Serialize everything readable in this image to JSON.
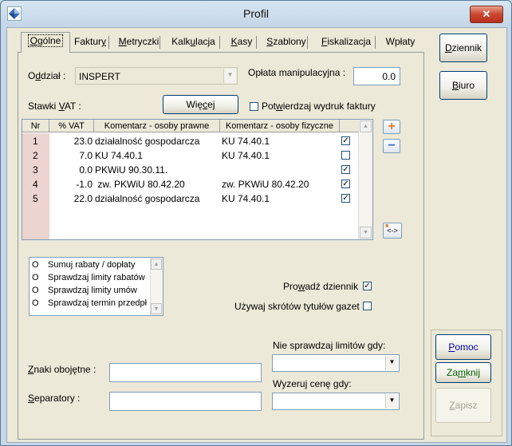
{
  "window": {
    "title": "Profil",
    "close_label": "✕"
  },
  "tabs": [
    {
      "pre": "",
      "u": "O",
      "post": "gólne",
      "active": true
    },
    {
      "pre": "Faktur",
      "u": "y",
      "post": ""
    },
    {
      "pre": "",
      "u": "M",
      "post": "etryczki"
    },
    {
      "pre": "Kalk",
      "u": "u",
      "post": "lacja"
    },
    {
      "pre": "",
      "u": "K",
      "post": "asy"
    },
    {
      "pre": "",
      "u": "S",
      "post": "zablony"
    },
    {
      "pre": "",
      "u": "F",
      "post": "iskalizacja"
    },
    {
      "pre": "",
      "u": "",
      "post": "Wpłaty"
    }
  ],
  "oddzial": {
    "label_pre": "O",
    "label_u": "d",
    "label_post": "dział :",
    "value": "INSPERT"
  },
  "oplata": {
    "label": "Opłata manipulacyjna :",
    "value": "0.0"
  },
  "stawki": {
    "label_pre": "Stawki ",
    "label_u": "V",
    "label_post": "AT :",
    "wiecej_pre": "Wię",
    "wiecej_u": "c",
    "wiecej_post": "ej"
  },
  "potwierdzaj": {
    "label_pre": "Pot",
    "label_u": "w",
    "label_post": "ierdzaj wydruk faktury"
  },
  "grid": {
    "headers": [
      "Nr",
      "% VAT",
      "Komentarz - osoby prawne",
      "Komentarz - osoby fizyczne"
    ],
    "rows": [
      {
        "nr": "1",
        "vat": "23.0",
        "prawne": "działalność gospodarcza",
        "fizyczne": "KU 74.40.1",
        "checked": true
      },
      {
        "nr": "2",
        "vat": "7.0",
        "prawne": "KU 74.40.1",
        "fizyczne": "KU 74.40.1",
        "checked": false
      },
      {
        "nr": "3",
        "vat": "0.0",
        "prawne": "PKWiU 90.30.11.",
        "fizyczne": "",
        "checked": true
      },
      {
        "nr": "4",
        "vat": "-1.0",
        "prawne": " zw. PKWiU 80.42.20",
        "fizyczne": "zw. PKWiU 80.42.20",
        "checked": true
      },
      {
        "nr": "5",
        "vat": "22.0",
        "prawne": "działalność gospodarcza",
        "fizyczne": "KU 74.40.1",
        "checked": true
      }
    ]
  },
  "grid_buttons": {
    "plus": "+",
    "minus": "−",
    "swap": "<->"
  },
  "options_list": [
    {
      "mark": "O",
      "text": "Sumuj rabaty / dopłaty"
    },
    {
      "mark": "O",
      "text": "Sprawdzaj limity rabatów"
    },
    {
      "mark": "O",
      "text": "Sprawdzaj limity umów"
    },
    {
      "mark": "O",
      "text": "Sprawdzaj termin przedpł"
    }
  ],
  "prowadz": {
    "pre": "Pro",
    "u": "w",
    "post": "adź dziennik",
    "checked": true
  },
  "skroty": {
    "label": "Używaj skrótów tytułów gazet",
    "checked": false
  },
  "znaki": {
    "pre": "",
    "u": "Z",
    "post": "naki obojętne :",
    "value": ""
  },
  "separatory": {
    "pre": "",
    "u": "S",
    "post": "eparatory :",
    "value": ""
  },
  "limity": {
    "label": "Nie sprawdzaj limitów gdy:",
    "value": ""
  },
  "wyzeruj": {
    "label": "Wyzeruj cenę gdy:",
    "value": ""
  },
  "right_buttons": {
    "dziennik": {
      "pre": "",
      "u": "D",
      "post": "ziennik"
    },
    "biuro": {
      "pre": "",
      "u": "B",
      "post": "iuro"
    },
    "pomoc": {
      "pre": "",
      "u": "P",
      "post": "omoc"
    },
    "zamknij": {
      "pre": "Za",
      "u": "m",
      "post": "knij"
    },
    "zapisz": {
      "pre": "",
      "u": "Z",
      "post": "apisz"
    }
  },
  "colors": {
    "accent_plus": "#e07a30",
    "accent_minus": "#2f6fd0",
    "nr_column": "#ecd4d0"
  }
}
